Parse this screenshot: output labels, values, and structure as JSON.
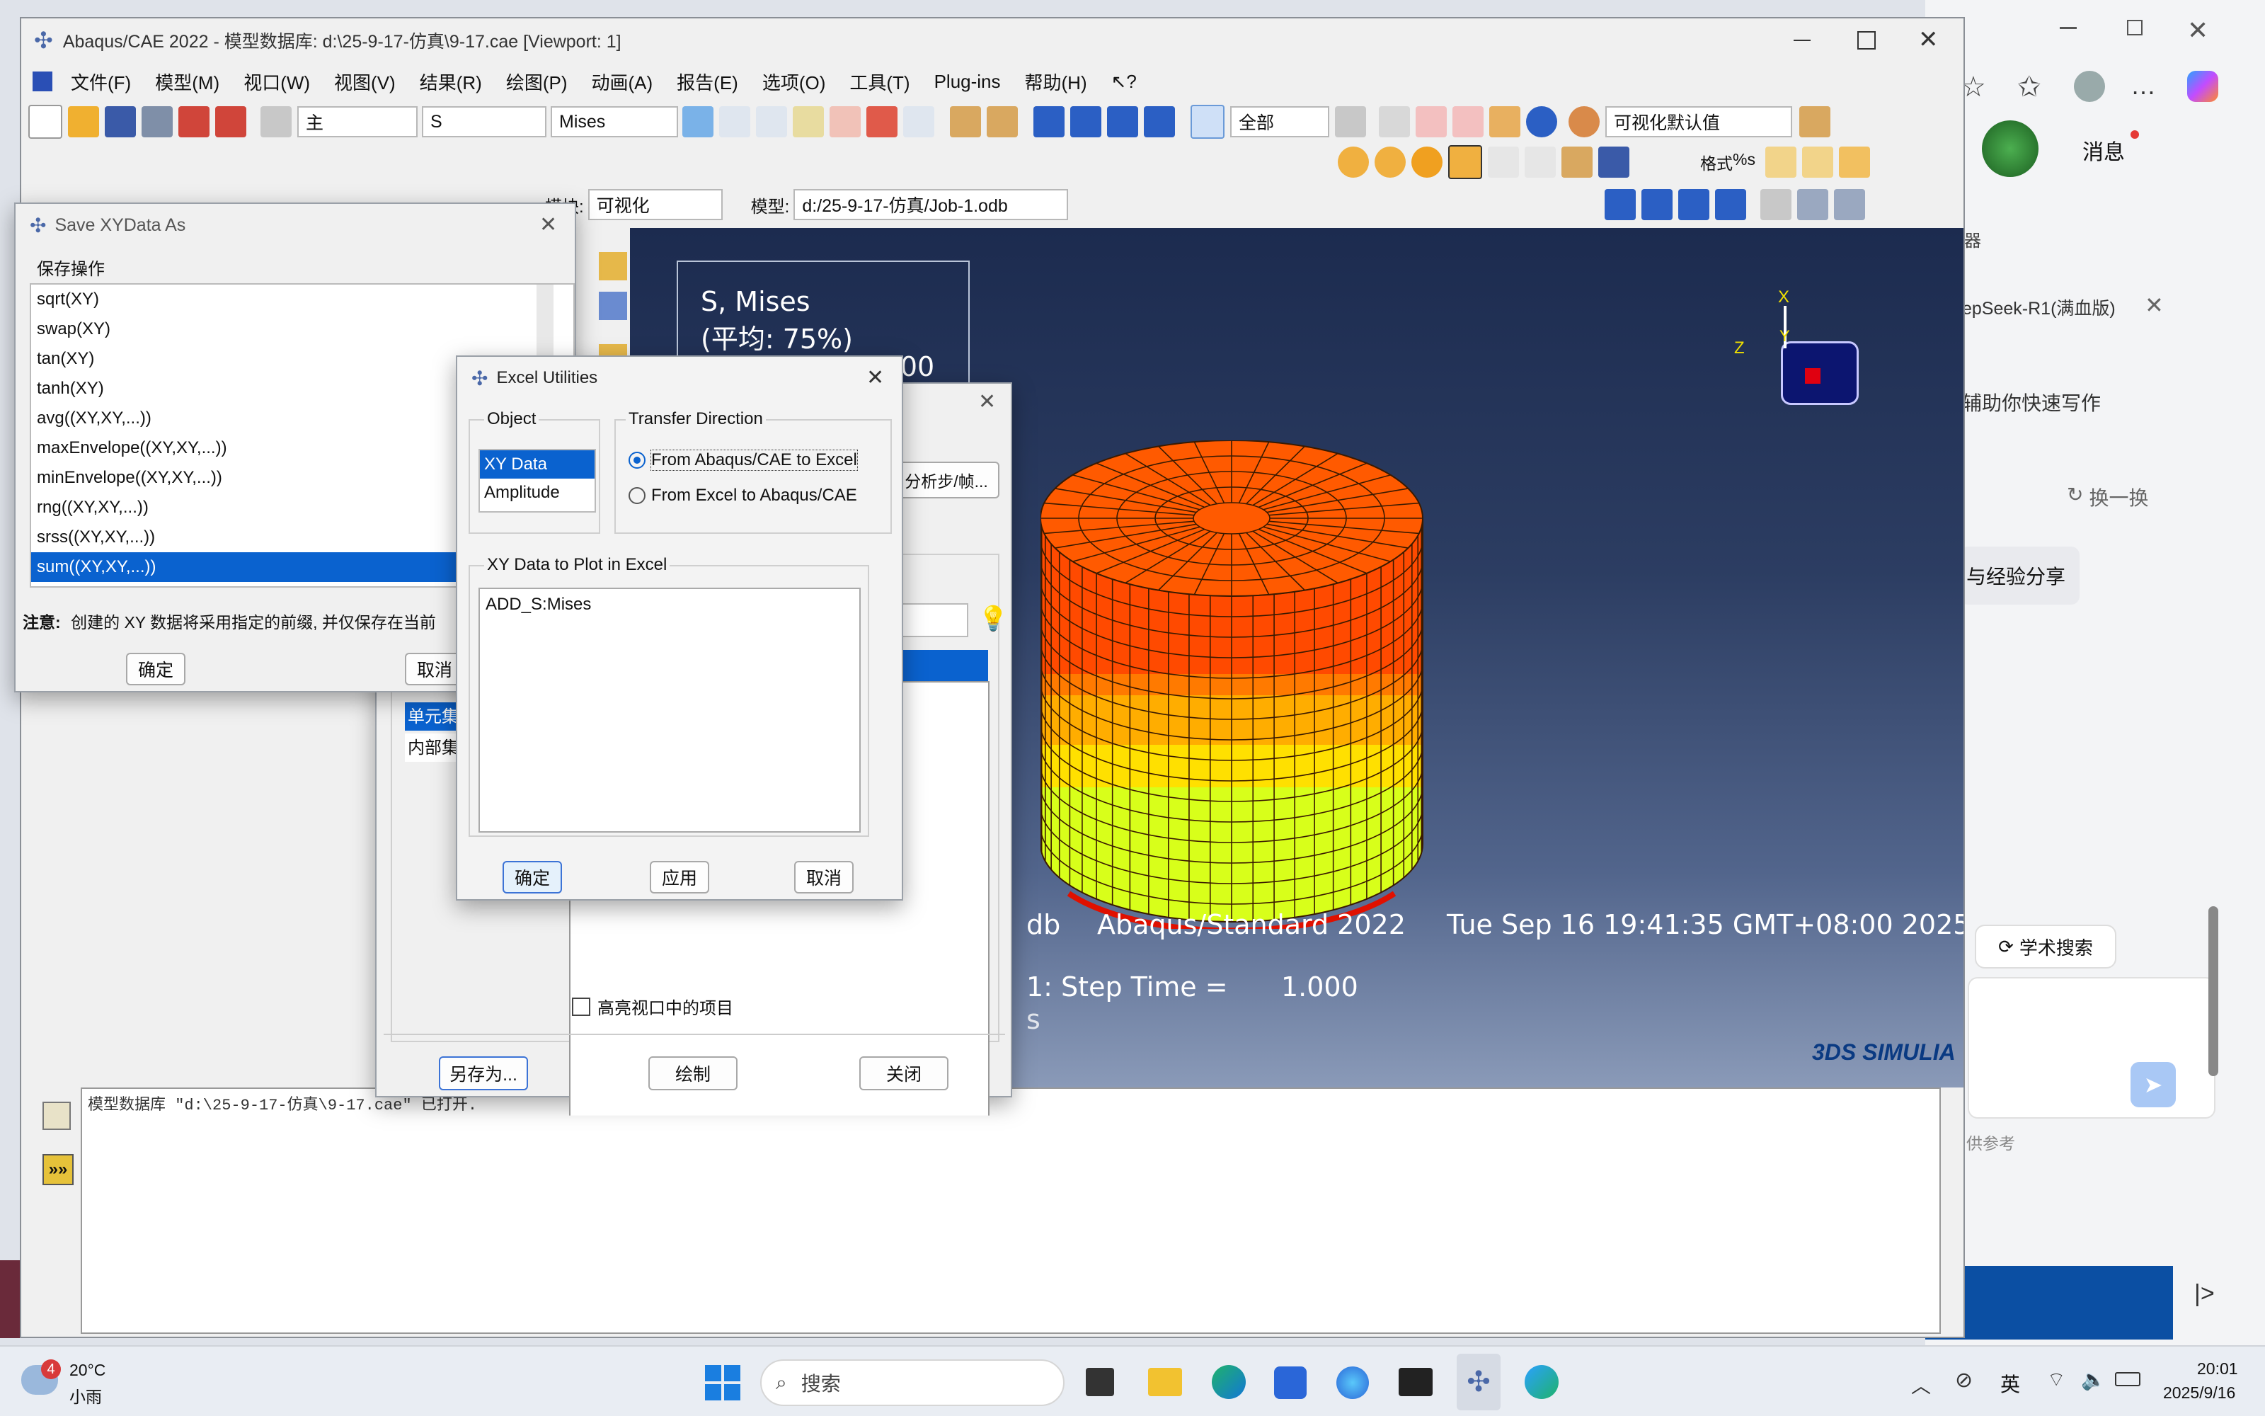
{
  "app": {
    "title": "Abaqus/CAE 2022 - 模型数据库: d:\\25-9-17-仿真\\9-17.cae [Viewport: 1]",
    "menus": [
      "文件(F)",
      "模型(M)",
      "视口(W)",
      "视图(V)",
      "结果(R)",
      "绘图(P)",
      "动画(A)",
      "报告(E)",
      "选项(O)",
      "工具(T)",
      "Plug-ins",
      "帮助(H)"
    ],
    "toolbar": {
      "combo_main": "主",
      "combo_var": "S",
      "combo_inv": "Mises",
      "combo_all": "全部",
      "combo_defaults": "可视化默认值",
      "format_label": "格式",
      "format_pct": "%s"
    },
    "module_label": "模块:",
    "module_value": "可视化",
    "model_label": "模型:",
    "model_value": "d:/25-9-17-仿真/Job-1.odb"
  },
  "viewport": {
    "legend_title": "S, Mises",
    "legend_avg": "(平均: 75%)",
    "legend_max": "+1.064e+00",
    "odb_suffix": "db",
    "product": "Abaqus/Standard 2022",
    "datetime": "Tue Sep 16 19:41:35 GMT+08:00 2025",
    "step_time_label": "1: Step Time =",
    "step_time_value": "1.000",
    "step_suffix": "s",
    "brand": "3DS SIMULIA",
    "triad": {
      "x": "X",
      "y": "Y",
      "z": "Z"
    },
    "colors": {
      "band1": "#ff4a00",
      "band2": "#ff7a00",
      "band3": "#ffad00",
      "band4": "#ffe000",
      "band5": "#d8ff1a",
      "bg_top": "#1c2b4f",
      "bg_bottom": "#8a9ab8"
    }
  },
  "save_dialog": {
    "title": "Save XYData As",
    "section": "保存操作",
    "items": [
      "sqrt(XY)",
      "swap(XY)",
      "tan(XY)",
      "tanh(XY)",
      "avg((XY,XY,...))",
      "maxEnvelope((XY,XY,...))",
      "minEnvelope((XY,XY,...))",
      "rng((XY,XY,...))",
      "srss((XY,XY,...))",
      "sum((XY,XY,...))"
    ],
    "selected_index": 9,
    "note_label": "注意:",
    "note": "创建的 XY 数据将采用指定的前缀, 并仅保存在当前",
    "ok": "确定",
    "cancel": "取消"
  },
  "xy_manager": {
    "step_button": "分析步/帧...",
    "list_items": [
      "单元集",
      "内部集"
    ],
    "highlight_check": "高亮视口中的项目",
    "save_as": "另存为...",
    "plot": "绘制",
    "close": "关闭"
  },
  "excel_dialog": {
    "title": "Excel Utilities",
    "object_label": "Object",
    "objects": [
      "XY Data",
      "Amplitude"
    ],
    "direction_label": "Transfer Direction",
    "directions": [
      "From Abaqus/CAE to Excel",
      "From Excel to Abaqus/CAE"
    ],
    "plot_label": "XY Data to Plot in Excel",
    "plot_items": [
      "ADD_S:Mises"
    ],
    "ok": "确定",
    "apply": "应用",
    "cancel": "取消"
  },
  "message_area": {
    "text": "模型数据库 \"d:\\25-9-17-仿真\\9-17.cae\" 已打开."
  },
  "browser": {
    "messages": "消息",
    "tab_text": "器",
    "ai_title": "epSeek-R1(满血版)",
    "writing_helper": "辅助你快速写作",
    "refresh": "换一换",
    "share": "与经验分享",
    "academic": "学术搜索",
    "disclaimer": "供参考"
  },
  "taskbar": {
    "weather_temp": "20°C",
    "weather_desc": "小雨",
    "weather_badge": "4",
    "search": "搜索",
    "ime": "英",
    "time": "20:01",
    "date": "2025/9/16"
  }
}
